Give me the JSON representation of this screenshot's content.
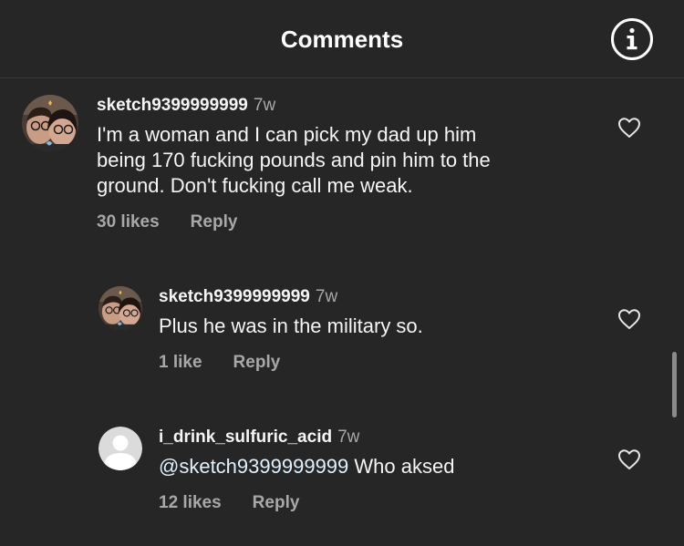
{
  "header": {
    "title": "Comments",
    "info_icon": "info-circle-icon"
  },
  "comments": [
    {
      "username": "sketch9399999999",
      "time": "7w",
      "text_lines": [
        "I'm a woman and I can pick my dad up him",
        "being 170 fucking pounds and pin him to the",
        "ground. Don't fucking call me weak."
      ],
      "likes": "30 likes",
      "reply": "Reply"
    },
    {
      "username": "sketch9399999999",
      "time": "7w",
      "text": "Plus he was in the military so.",
      "likes": "1 like",
      "reply": "Reply"
    },
    {
      "username": "i_drink_sulfuric_acid",
      "time": "7w",
      "mention": "@sketch9399999999",
      "text": " Who aksed",
      "likes": "12 likes",
      "reply": "Reply"
    }
  ],
  "colors": {
    "background": "#262626",
    "text": "#f5f5f5",
    "secondary": "#a8a8a8",
    "mention": "#e0f1ff",
    "divider": "#3a3a3a"
  }
}
